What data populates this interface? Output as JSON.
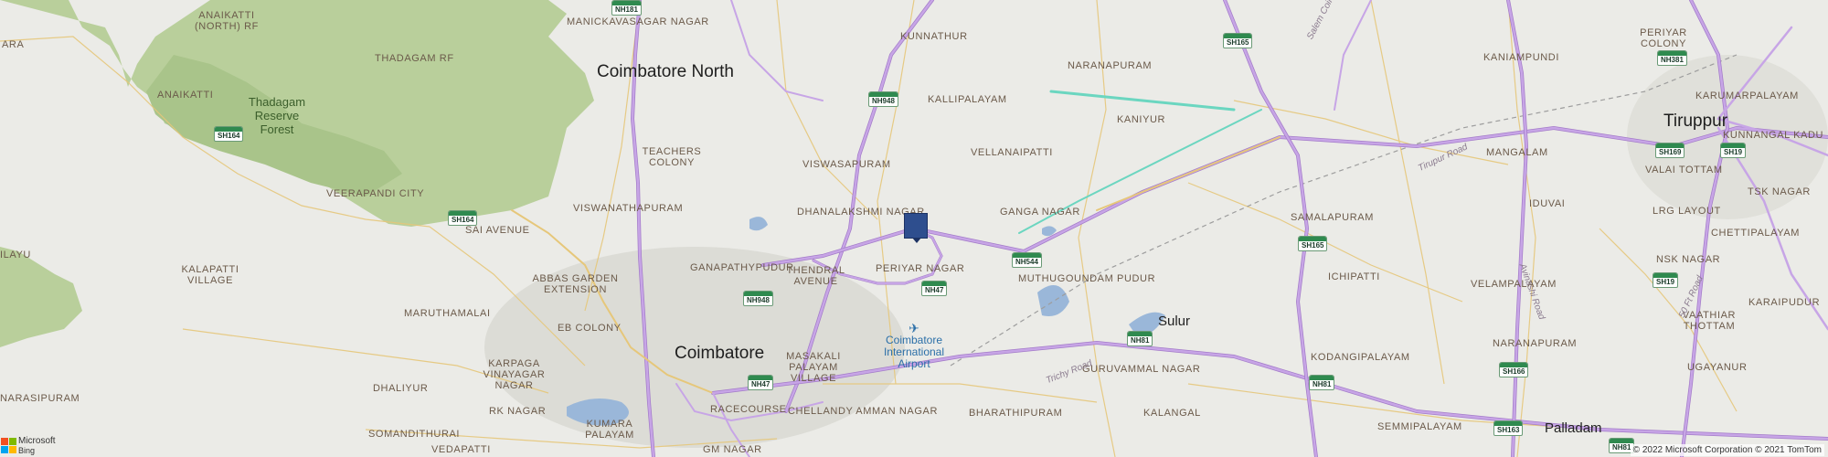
{
  "map": {
    "cities": [
      {
        "id": "coimbatore-north",
        "text": "Coimbatore North"
      },
      {
        "id": "coimbatore",
        "text": "Coimbatore"
      },
      {
        "id": "tiruppur",
        "text": "Tiruppur"
      }
    ],
    "towns": [
      {
        "id": "sulur",
        "text": "Sulur"
      },
      {
        "id": "palladam",
        "text": "Palladam"
      }
    ],
    "forests": [
      {
        "id": "thadagam-reserve-forest",
        "text": "Thadagam Reserve Forest"
      }
    ],
    "airport": {
      "text": "Coimbatore International Airport",
      "icon": "airplane-icon"
    },
    "localities": [
      {
        "id": "anaikatti-north",
        "text": "ANAIKATTI (NORTH) RF"
      },
      {
        "id": "ara",
        "text": "ARA"
      },
      {
        "id": "thadagam-rf",
        "text": "THADAGAM RF"
      },
      {
        "id": "anaikatti",
        "text": "ANAIKATTI"
      },
      {
        "id": "manickavasagar-nagar",
        "text": "MANICKAVASAGAR NAGAR"
      },
      {
        "id": "kunnathur",
        "text": "KUNNATHUR"
      },
      {
        "id": "naranapuram",
        "text": "NARANAPURAM"
      },
      {
        "id": "kallipalayam",
        "text": "KALLIPALAYAM"
      },
      {
        "id": "kaniyur",
        "text": "KANIYUR"
      },
      {
        "id": "kaniampundi",
        "text": "KANIAMPUNDI"
      },
      {
        "id": "periyar-colony",
        "text": "PERIYAR COLONY"
      },
      {
        "id": "karumarpalayam",
        "text": "KARUMARPALAYAM"
      },
      {
        "id": "teachers-colony",
        "text": "TEACHERS COLONY"
      },
      {
        "id": "viswasapuram",
        "text": "VISWASAPURAM"
      },
      {
        "id": "vellanaipatti",
        "text": "VELLANAIPATTI"
      },
      {
        "id": "mangalam",
        "text": "MANGALAM"
      },
      {
        "id": "kunnangal-kadu",
        "text": "KUNNANGAL KADU"
      },
      {
        "id": "valai-tottam",
        "text": "VALAI TOTTAM"
      },
      {
        "id": "veerapandi-city",
        "text": "VEERAPANDI CITY"
      },
      {
        "id": "tsk-nagar",
        "text": "TSK NAGAR"
      },
      {
        "id": "viswanathapuram",
        "text": "VISWANATHAPURAM"
      },
      {
        "id": "dhanalakshmi-nagar",
        "text": "DHANALAKSHMI NAGAR"
      },
      {
        "id": "ganga-nagar",
        "text": "GANGA NAGAR"
      },
      {
        "id": "samalapuram",
        "text": "SAMALAPURAM"
      },
      {
        "id": "iduvai",
        "text": "IDUVAI"
      },
      {
        "id": "lrg-layout",
        "text": "LRG LAYOUT"
      },
      {
        "id": "sai-avenue",
        "text": "SAI AVENUE"
      },
      {
        "id": "ilayu",
        "text": "ILAYU"
      },
      {
        "id": "chettipalayam",
        "text": "CHETTIPALAYAM"
      },
      {
        "id": "kalapatti-village",
        "text": "KALAPATTI VILLAGE"
      },
      {
        "id": "abbas-garden-extension",
        "text": "ABBAS GARDEN EXTENSION"
      },
      {
        "id": "ganapathypudur",
        "text": "GANAPATHYPUDUR"
      },
      {
        "id": "thendral-avenue",
        "text": "THENDRAL AVENUE"
      },
      {
        "id": "periyar-nagar",
        "text": "PERIYAR NAGAR"
      },
      {
        "id": "muthugoundam-pudur",
        "text": "MUTHUGOUNDAM PUDUR"
      },
      {
        "id": "ichipatti",
        "text": "ICHIPATTI"
      },
      {
        "id": "velampalayam",
        "text": "VELAMPALAYAM"
      },
      {
        "id": "nsk-nagar",
        "text": "NSK NAGAR"
      },
      {
        "id": "maruthamalai",
        "text": "MARUTHAMALAI"
      },
      {
        "id": "karaipudur",
        "text": "KARAIPUDUR"
      },
      {
        "id": "eb-colony",
        "text": "EB COLONY"
      },
      {
        "id": "vaathiar-thottam",
        "text": "VAATHIAR THOTTAM"
      },
      {
        "id": "masakali-palayam-village",
        "text": "MASAKALI PALAYAM VILLAGE"
      },
      {
        "id": "kodangipalayam",
        "text": "KODANGIPALAYAM"
      },
      {
        "id": "guruvammal-nagar",
        "text": "GURUVAMMAL NAGAR"
      },
      {
        "id": "dhaliyur",
        "text": "DHALIYUR"
      },
      {
        "id": "karpaga-vinayagar-nagar",
        "text": "KARPAGA VINAYAGAR NAGAR"
      },
      {
        "id": "naranapuram-2",
        "text": "NARANAPURAM"
      },
      {
        "id": "ugayanur",
        "text": "UGAYANUR"
      },
      {
        "id": "narasipuram",
        "text": "NARASIPURAM"
      },
      {
        "id": "rk-nagar",
        "text": "RK NAGAR"
      },
      {
        "id": "racecourse",
        "text": "RACECOURSE"
      },
      {
        "id": "chellandy-amman-nagar",
        "text": "CHELLANDY AMMAN NAGAR"
      },
      {
        "id": "bharathipuram",
        "text": "BHARATHIPURAM"
      },
      {
        "id": "kalangal",
        "text": "KALANGAL"
      },
      {
        "id": "kumara-palayam",
        "text": "KUMARA PALAYAM"
      },
      {
        "id": "somandithurai",
        "text": "SOMANDITHURAI"
      },
      {
        "id": "semmipalayam",
        "text": "SEMMIPALAYAM"
      },
      {
        "id": "vedapatti",
        "text": "VEDAPATTI"
      },
      {
        "id": "gm-nagar",
        "text": "GM NAGAR"
      }
    ],
    "road_names": [
      {
        "id": "salem-coimbatore",
        "text": "Salem Coimbatore"
      },
      {
        "id": "tirupur-road",
        "text": "Tirupur Road"
      },
      {
        "id": "avinashi-road",
        "text": "Avinashi Road"
      },
      {
        "id": "50-ft-road",
        "text": "50 Ft Road"
      },
      {
        "id": "trichy-road",
        "text": "Trichy Road"
      }
    ],
    "shields": [
      {
        "id": "nh181-top",
        "text": "NH181"
      },
      {
        "id": "sh165-top",
        "text": "SH165"
      },
      {
        "id": "nh381",
        "text": "NH381"
      },
      {
        "id": "nh948-north",
        "text": "NH948"
      },
      {
        "id": "sh164-forest",
        "text": "SH164"
      },
      {
        "id": "sh169",
        "text": "SH169"
      },
      {
        "id": "sh19-tiruppur",
        "text": "SH19"
      },
      {
        "id": "sh164-west",
        "text": "SH164"
      },
      {
        "id": "sh165-mid",
        "text": "SH165"
      },
      {
        "id": "nh544",
        "text": "NH544"
      },
      {
        "id": "sh19-south",
        "text": "SH19"
      },
      {
        "id": "nh948-south",
        "text": "NH948"
      },
      {
        "id": "nh47-airport",
        "text": "NH47"
      },
      {
        "id": "nh81-sulur",
        "text": "NH81"
      },
      {
        "id": "nh47-south",
        "text": "NH47"
      },
      {
        "id": "nh81-south",
        "text": "NH81"
      },
      {
        "id": "sh166",
        "text": "SH166"
      },
      {
        "id": "sh163",
        "text": "SH163"
      },
      {
        "id": "nh81-palladam",
        "text": "NH81"
      }
    ],
    "marker": {
      "icon": "location-pin-icon",
      "color": "#2e4e8e"
    }
  },
  "attribution": {
    "logo_text": "Microsoft",
    "logo_sub": "Bing",
    "copyright": "© 2022 Microsoft Corporation © 2021 TomTom"
  },
  "colors": {
    "background": "#ebebe7",
    "forest": "#a9c48a",
    "highway": "#c7a5e6",
    "highway_edge": "#a47cc9",
    "road": "#e6c77a",
    "water": "#9ab7d9",
    "urban": "#dcdcd6"
  }
}
